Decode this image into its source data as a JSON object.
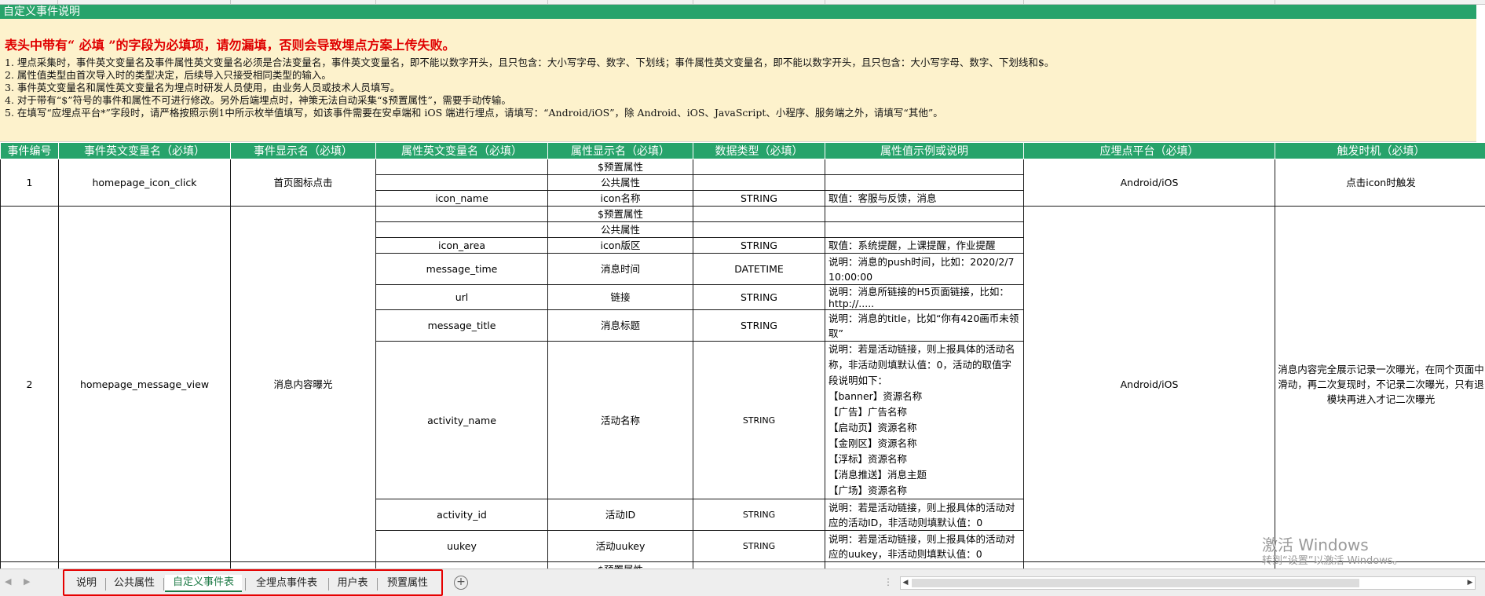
{
  "sheet": {
    "title": "自定义事件说明",
    "warning": "表头中带有“ 必填 ”的字段为必填项，请勿漏填，否则会导致埋点方案上传失败。",
    "notes": [
      "1. 埋点采集时，事件英文变量名及事件属性英文变量名必须是合法变量名，事件英文变量名，即不能以数字开头，且只包含：大小写字母、数字、下划线；事件属性英文变量名，即不能以数字开头，且只包含：大小写字母、数字、下划线和$。",
      "2. 属性值类型由首次导入时的类型决定，后续导入只接受相同类型的输入。",
      "3. 事件英文变量名和属性英文变量名为埋点时研发人员使用，由业务人员或技术人员填写。",
      "4. 对于带有“$”符号的事件和属性不可进行修改。另外后端埋点时，神策无法自动采集“$预置属性”，需要手动传输。",
      "5. 在填写“应埋点平台*”字段时，请严格按照示例1中所示枚举值填写，如该事件需要在安卓端和 iOS 端进行埋点，请填写：“Android/iOS”，除 Android、iOS、JavaScript、小程序、服务端之外，请填写“其他”。"
    ],
    "headers": [
      "事件编号",
      "事件英文变量名（必填）",
      "事件显示名（必填）",
      "属性英文变量名（必填）",
      "属性显示名（必填）",
      "数据类型（必填）",
      "属性值示例或说明",
      "应埋点平台（必填）",
      "触发时机（必填）"
    ],
    "events": [
      {
        "id": "1",
        "name": "homepage_icon_click",
        "display": "首页图标点击",
        "platform": "Android/iOS",
        "trigger": "点击icon时触发",
        "props": [
          {
            "name": "",
            "display": "$预置属性",
            "type": "",
            "desc": ""
          },
          {
            "name": "",
            "display": "公共属性",
            "type": "",
            "desc": ""
          },
          {
            "name": "icon_name",
            "display": "icon名称",
            "type": "STRING",
            "desc": "取值：客服与反馈，消息"
          }
        ]
      },
      {
        "id": "2",
        "name": "homepage_message_view",
        "display": "消息内容曝光",
        "platform": "Android/iOS",
        "trigger": "消息内容完全展示记录一次曝光，在同个页面中滑动，再二次复现时，不记录二次曝光，只有退模块再进入才记二次曝光",
        "props": [
          {
            "name": "",
            "display": "$预置属性",
            "type": "",
            "desc": ""
          },
          {
            "name": "",
            "display": "公共属性",
            "type": "",
            "desc": ""
          },
          {
            "name": "icon_area",
            "display": "icon版区",
            "type": "STRING",
            "desc": "取值：系统提醒，上课提醒，作业提醒"
          },
          {
            "name": "message_time",
            "display": "消息时间",
            "type": "DATETIME",
            "desc": "说明：消息的push时间，比如：2020/2/7 10:00:00"
          },
          {
            "name": "url",
            "display": "链接",
            "type": "STRING",
            "desc": "说明：消息所链接的H5页面链接，比如：http://....."
          },
          {
            "name": "message_title",
            "display": "消息标题",
            "type": "STRING",
            "desc": "说明：消息的title，比如“你有420画币未领取”"
          },
          {
            "name": "activity_name",
            "display": "活动名称",
            "type": "STRING",
            "desc": "说明：若是活动链接，则上报具体的活动名称，非活动则填默认值：0，活动的取值字段说明如下：\n【banner】资源名称\n【广告】广告名称\n【启动页】资源名称\n【金刚区】资源名称\n【浮标】资源名称\n【消息推送】消息主题\n【广场】资源名称"
          },
          {
            "name": "activity_id",
            "display": "活动ID",
            "type": "STRING",
            "desc": "说明：若是活动链接，则上报具体的活动对应的活动ID，非活动则填默认值：0"
          },
          {
            "name": "uukey",
            "display": "活动uukey",
            "type": "STRING",
            "desc": "说明：若是活动链接，则上报具体的活动对应的uukey，非活动则填默认值：0"
          }
        ]
      },
      {
        "id": "",
        "name": "",
        "display": "",
        "platform": "",
        "trigger": "",
        "props": [
          {
            "name": "",
            "display": "$预置属性",
            "type": "",
            "desc": ""
          }
        ]
      }
    ]
  },
  "tabs": [
    {
      "label": "说明",
      "active": false
    },
    {
      "label": "公共属性",
      "active": false
    },
    {
      "label": "自定义事件表",
      "active": true
    },
    {
      "label": "全埋点事件表",
      "active": false
    },
    {
      "label": "用户表",
      "active": false
    },
    {
      "label": "预置属性",
      "active": false
    }
  ],
  "add_sheet_label": "+",
  "watermark": {
    "line1": "激活 Windows",
    "line2": "转到“设置”以激活 Windows。"
  },
  "colors": {
    "header_green": "#27a36b",
    "notes_bg": "#fdf2cc",
    "warning_red": "#e00000",
    "highlight_box": "#e60000"
  }
}
